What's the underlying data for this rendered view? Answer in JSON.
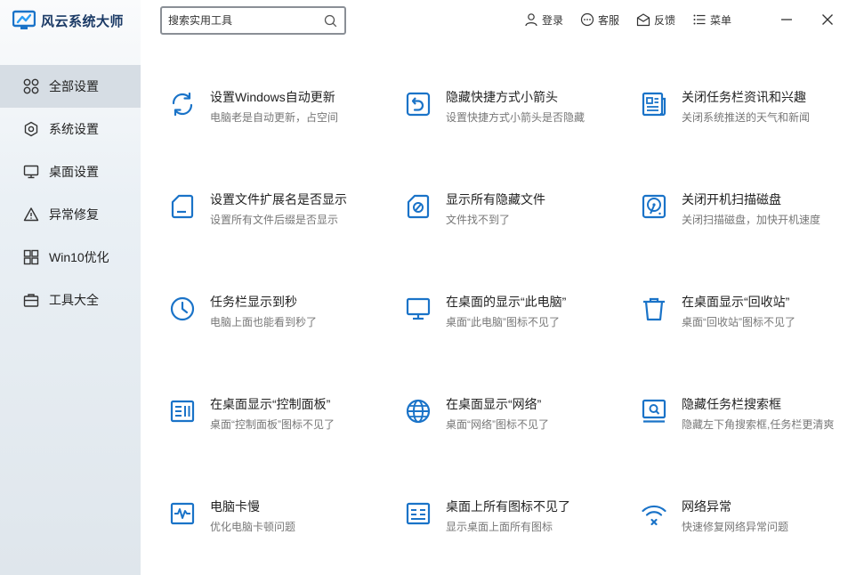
{
  "app": {
    "title": "风云系统大师",
    "accent_color": "#1a73c8"
  },
  "search": {
    "placeholder": "搜索实用工具",
    "icon": "search-icon"
  },
  "top_actions": [
    {
      "label": "登录",
      "icon": "user-icon"
    },
    {
      "label": "客服",
      "icon": "chat-icon"
    },
    {
      "label": "反馈",
      "icon": "feedback-icon"
    },
    {
      "label": "菜单",
      "icon": "menu-icon"
    }
  ],
  "sidebar": {
    "items": [
      {
        "label": "全部设置",
        "icon": "grid-icon",
        "active": true
      },
      {
        "label": "系统设置",
        "icon": "gear-icon",
        "active": false
      },
      {
        "label": "桌面设置",
        "icon": "monitor-icon",
        "active": false
      },
      {
        "label": "异常修复",
        "icon": "warning-icon",
        "active": false
      },
      {
        "label": "Win10优化",
        "icon": "windows-icon",
        "active": false
      },
      {
        "label": "工具大全",
        "icon": "toolbox-icon",
        "active": false
      }
    ]
  },
  "tiles": [
    {
      "title": "设置Windows自动更新",
      "desc": "电脑老是自动更新，占空间",
      "icon": "refresh-icon"
    },
    {
      "title": "隐藏快捷方式小箭头",
      "desc": "设置快捷方式小箭头是否隐藏",
      "icon": "shortcut-arrow-icon"
    },
    {
      "title": "关闭任务栏资讯和兴趣",
      "desc": "关闭系统推送的天气和新闻",
      "icon": "news-icon"
    },
    {
      "title": "设置文件扩展名是否显示",
      "desc": "设置所有文件后缀是否显示",
      "icon": "file-icon"
    },
    {
      "title": "显示所有隐藏文件",
      "desc": "文件找不到了",
      "icon": "hidden-file-icon"
    },
    {
      "title": "关闭开机扫描磁盘",
      "desc": "关闭扫描磁盘，加快开机速度",
      "icon": "disk-icon"
    },
    {
      "title": "任务栏显示到秒",
      "desc": "电脑上面也能看到秒了",
      "icon": "clock-icon"
    },
    {
      "title": "在桌面的显示“此电脑”",
      "desc": "桌面“此电脑”图标不见了",
      "icon": "computer-icon"
    },
    {
      "title": "在桌面显示“回收站”",
      "desc": "桌面“回收站”图标不见了",
      "icon": "recycle-bin-icon"
    },
    {
      "title": "在桌面显示“控制面板”",
      "desc": "桌面“控制面板”图标不见了",
      "icon": "control-panel-icon"
    },
    {
      "title": "在桌面显示“网络”",
      "desc": "桌面“网络”图标不见了",
      "icon": "globe-icon"
    },
    {
      "title": "隐藏任务栏搜索框",
      "desc": "隐藏左下角搜索框,任务栏更清爽",
      "icon": "search-box-icon"
    },
    {
      "title": "电脑卡慢",
      "desc": "优化电脑卡顿问题",
      "icon": "pulse-icon"
    },
    {
      "title": "桌面上所有图标不见了",
      "desc": "显示桌面上面所有图标",
      "icon": "desktop-icons-icon"
    },
    {
      "title": "网络异常",
      "desc": "快速修复网络异常问题",
      "icon": "wifi-error-icon"
    }
  ]
}
